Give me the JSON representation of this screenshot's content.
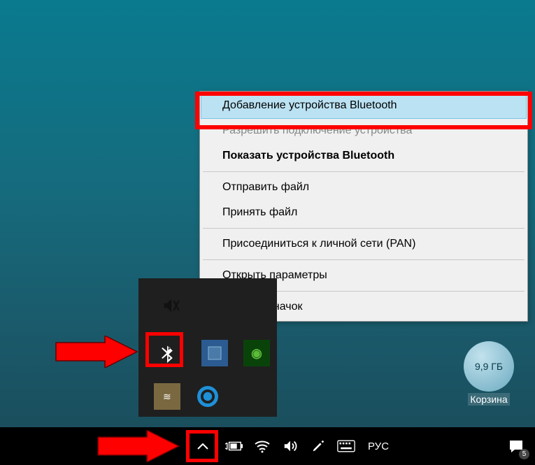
{
  "context_menu": {
    "items": [
      {
        "label": "Добавление устройства Bluetooth",
        "highlighted": true
      },
      {
        "label": "Разрешить подключение устройства",
        "disabled": true
      },
      {
        "label": "Показать устройства Bluetooth",
        "bold": true
      },
      {
        "label": "Отправить файл"
      },
      {
        "label": "Принять файл"
      },
      {
        "label": "Присоединиться к личной сети (PAN)"
      },
      {
        "label": "Открыть параметры"
      },
      {
        "label": "Удалить значок"
      }
    ]
  },
  "recycle_bin": {
    "size_label": "9,9 ГБ",
    "label": "Корзина"
  },
  "taskbar": {
    "language": "РУС",
    "notification_count": "5"
  }
}
